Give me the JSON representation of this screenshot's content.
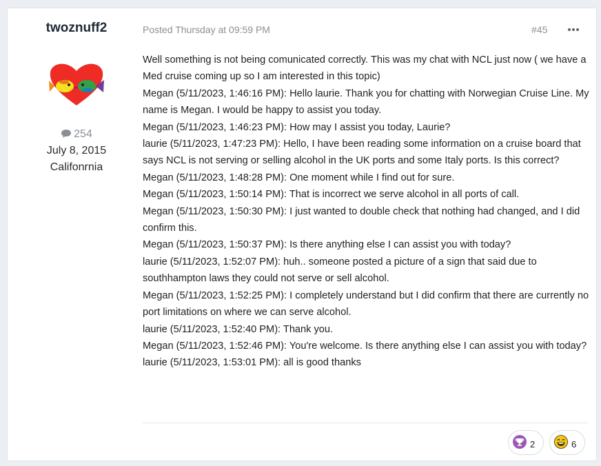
{
  "author": {
    "username": "twoznuff2",
    "avatar_icon": "heart-with-kissing-fish-avatar",
    "post_count": "254",
    "post_count_icon": "comment-icon",
    "joined": "July 8, 2015",
    "location": "Califonrnia"
  },
  "post": {
    "meta": "Posted Thursday at 09:59 PM",
    "number": "#45",
    "more_icon": "ellipsis-icon",
    "lines": [
      "Well something is not being comunicated correctly. This was my chat with NCL just now ( we have a Med cruise coming up so I am interested in this topic)",
      "Megan (5/11/2023, 1:46:16 PM): Hello laurie. Thank you for chatting with Norwegian Cruise Line. My name is Megan. I would be happy to assist you today.",
      "Megan (5/11/2023, 1:46:23 PM): How may I assist you today, Laurie?",
      "laurie (5/11/2023, 1:47:23 PM): Hello, I have been reading some information on a cruise board that says NCL is not serving or selling alcohol in the UK ports and some Italy ports. Is this correct?",
      "Megan (5/11/2023, 1:48:28 PM): One moment while I find out for sure.",
      "Megan (5/11/2023, 1:50:14 PM): That is incorrect we serve alcohol in all ports of call.",
      "Megan (5/11/2023, 1:50:30 PM): I just wanted to double check that nothing had changed, and I did confirm this.",
      "Megan (5/11/2023, 1:50:37 PM): Is there anything else I can assist you with today?",
      "laurie (5/11/2023, 1:52:07 PM): huh.. someone posted a picture of a sign that said due to southhampton laws they could not serve or sell alcohol.",
      "Megan (5/11/2023, 1:52:25 PM): I completely understand but I did confirm that there are currently no port limitations on where we can serve alcohol.",
      "laurie (5/11/2023, 1:52:40 PM): Thank you.",
      "Megan (5/11/2023, 1:52:46 PM): You're welcome.  Is there anything else I can assist you with today?",
      "laurie (5/11/2023, 1:53:01 PM): all is good thanks"
    ]
  },
  "reactions": [
    {
      "icon": "trophy-icon",
      "count": "2",
      "color": "#9b59b6"
    },
    {
      "icon": "laughing-face-icon",
      "count": "6",
      "color": "#f5c518"
    }
  ]
}
